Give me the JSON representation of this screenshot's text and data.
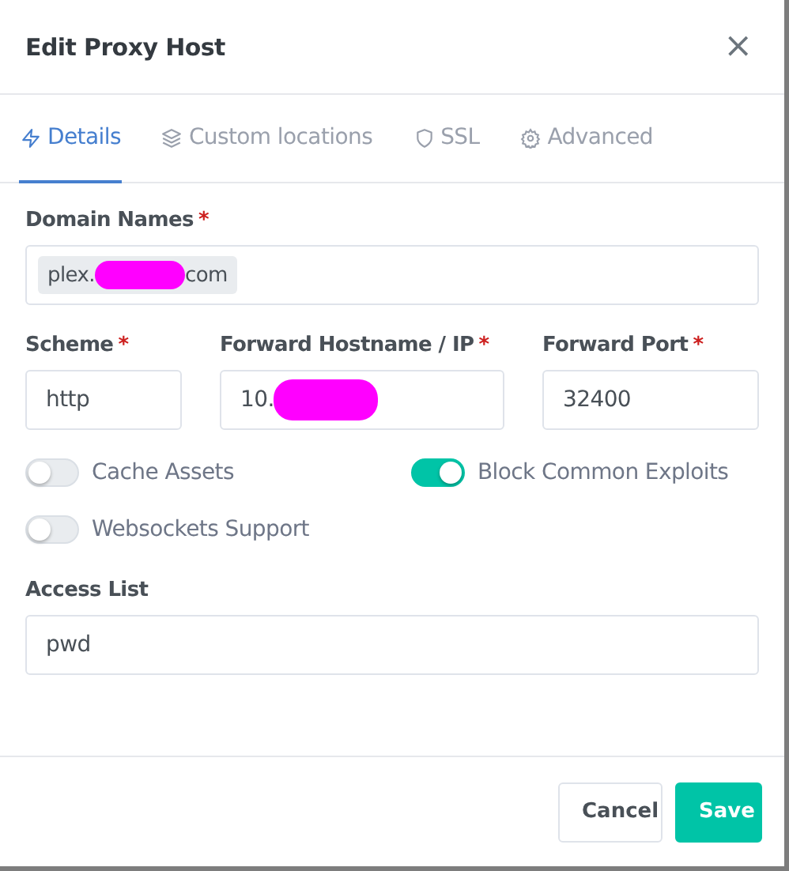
{
  "modal": {
    "title": "Edit Proxy Host",
    "close": "×"
  },
  "tabs": [
    {
      "label": "Details",
      "selected": true
    },
    {
      "label": "Custom locations",
      "selected": false
    },
    {
      "label": "SSL",
      "selected": false
    },
    {
      "label": "Advanced",
      "selected": false
    }
  ],
  "domain_names": {
    "label": "Domain Names",
    "required_mark": "*",
    "tags": [
      {
        "parts": [
          "plex.",
          "com"
        ],
        "redacted": true
      }
    ]
  },
  "fields": [
    {
      "label": "Scheme",
      "required_mark": "*",
      "value": "http"
    },
    {
      "label": "Forward Hostname / IP",
      "required_mark": "*",
      "value": "10.",
      "redacted": true
    },
    {
      "label": "Forward Port",
      "required_mark": "*",
      "value": "32400"
    }
  ],
  "toggles": [
    {
      "label": "Cache Assets",
      "on": false
    },
    {
      "label": "Block Common Exploits",
      "on": true
    },
    {
      "label": "Websockets Support",
      "on": false
    }
  ],
  "access_list": {
    "label": "Access List",
    "value": "pwd"
  },
  "buttons": [
    {
      "label": "Cancel",
      "kind": "secondary"
    },
    {
      "label": "Save",
      "kind": "primary"
    }
  ]
}
